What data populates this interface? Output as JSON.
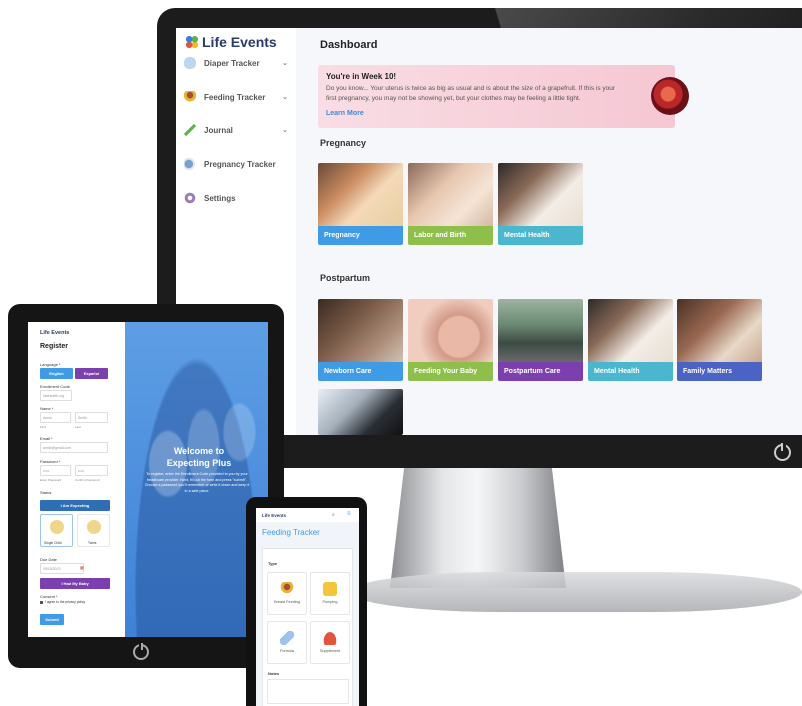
{
  "desktop": {
    "brand": {
      "name": "Life Events"
    },
    "sidebar": {
      "items": [
        {
          "label": "Diaper Tracker",
          "icon": "diaper-icon",
          "has_chevron": true
        },
        {
          "label": "Feeding Tracker",
          "icon": "feeding-icon",
          "has_chevron": true
        },
        {
          "label": "Journal",
          "icon": "pencil-icon",
          "has_chevron": true
        },
        {
          "label": "Pregnancy Tracker",
          "icon": "ultrasound-icon",
          "has_chevron": false
        },
        {
          "label": "Settings",
          "icon": "gear-icon",
          "has_chevron": false
        }
      ]
    },
    "main": {
      "title": "Dashboard",
      "banner": {
        "title": "You're in Week 10!",
        "body": "Do you know... Your uterus is twice as big as usual and is about the size of a grapefruit. If this is your first pregnancy, you may not be showing yet, but your clothes may be feeling a little tight.",
        "link": "Learn More"
      },
      "pregnancy": {
        "heading": "Pregnancy",
        "cards": [
          {
            "label": "Pregnancy",
            "color": "#3f9be6"
          },
          {
            "label": "Labor and Birth",
            "color": "#8dbf4a"
          },
          {
            "label": "Mental Health",
            "color": "#4bb7cf"
          }
        ]
      },
      "postpartum": {
        "heading": "Postpartum",
        "cards": [
          {
            "label": "Newborn Care",
            "color": "#3f9be6"
          },
          {
            "label": "Feeding Your Baby",
            "color": "#8dbf4a"
          },
          {
            "label": "Postpartum Care",
            "color": "#7b3fae"
          },
          {
            "label": "Mental Health",
            "color": "#4bb7cf"
          },
          {
            "label": "Family Matters",
            "color": "#4a63c5"
          }
        ]
      }
    }
  },
  "tablet": {
    "brand": "Life Events",
    "title": "Register",
    "language_label": "Language *",
    "language_options": [
      "English",
      "Español"
    ],
    "enrollment_label": "Enrollment Code",
    "enrollment_value": "Nathealth.org",
    "name_label": "Name *",
    "first_value": "Annie",
    "last_value": "Smith",
    "first_hint": "First",
    "last_hint": "Last",
    "email_label": "Email *",
    "email_value": "annie@gmail.com",
    "password_label": "Password *",
    "password_value": "•••••",
    "confirm_value": "•••••",
    "password_hint": "Enter Password",
    "confirm_hint": "Confirm Password",
    "status_label": "Status",
    "expecting_button": "I Am Expecting",
    "single_label": "Single Child",
    "twins_label": "Twins",
    "due_label": "Due Date",
    "due_value": "05/15/2023",
    "had_baby_button": "I Had My Baby",
    "consent_label": "Consent *",
    "consent_text": "I agree to the privacy policy",
    "submit": "Submit",
    "welcome_title": "Welcome to Expecting Plus",
    "welcome_body": "To register, enter the Enrollment Code provided to you by your healthcare provider. Next, fill out the form and press \"submit\". Choose a password you'll remember or write it down and keep it in a safe place."
  },
  "phone": {
    "brand": "Life Events",
    "title": "Feeding Tracker",
    "type_label": "Type",
    "options": [
      "Breast Feeding",
      "Pumping",
      "Formula",
      "Supplement"
    ],
    "notes_label": "Notes"
  }
}
